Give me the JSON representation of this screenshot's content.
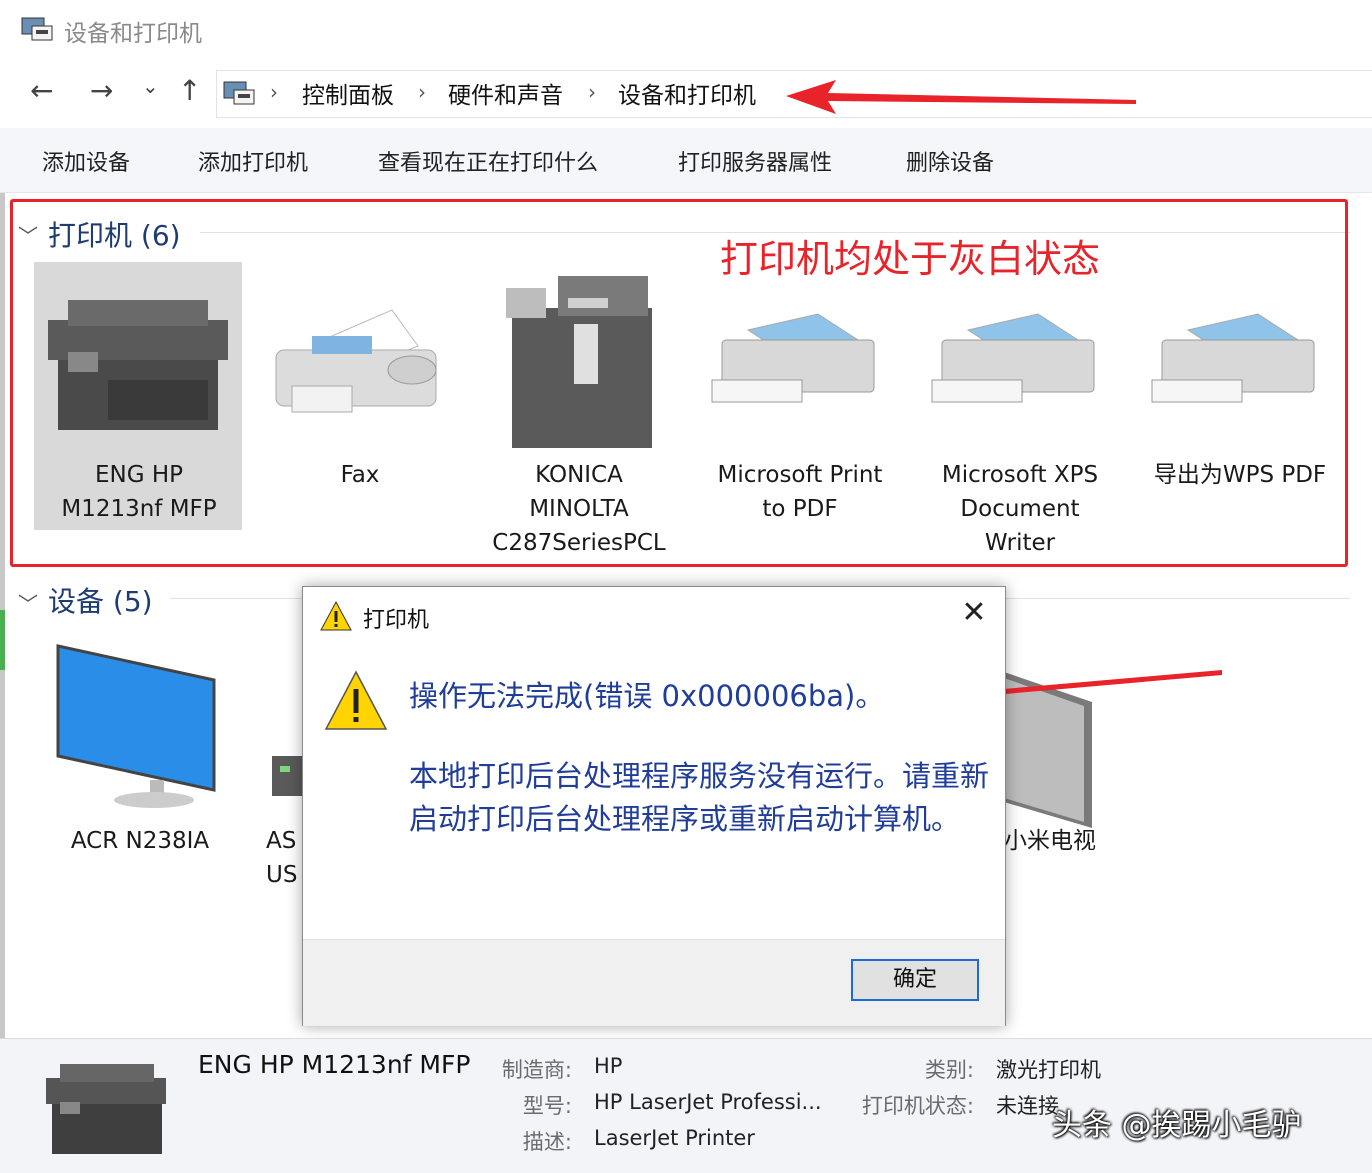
{
  "window": {
    "title": "设备和打印机"
  },
  "nav": {
    "back": "←",
    "forward": "→",
    "recent": "⌄",
    "up": "↑",
    "breadcrumb": [
      "控制面板",
      "硬件和声音",
      "设备和打印机"
    ],
    "sep": "›"
  },
  "toolbar": {
    "items": [
      "添加设备",
      "添加打印机",
      "查看现在正在打印什么",
      "打印服务器属性",
      "删除设备"
    ]
  },
  "printers": {
    "header": "打印机 (6)",
    "annotation": "打印机均处于灰白状态",
    "items": [
      {
        "line1": "ENG HP",
        "line2": "M1213nf MFP",
        "line3": ""
      },
      {
        "line1": "Fax",
        "line2": "",
        "line3": ""
      },
      {
        "line1": "KONICA",
        "line2": "MINOLTA",
        "line3": "C287SeriesPCL"
      },
      {
        "line1": "Microsoft Print",
        "line2": "to PDF",
        "line3": ""
      },
      {
        "line1": "Microsoft XPS",
        "line2": "Document",
        "line3": "Writer"
      },
      {
        "line1": "导出为WPS PDF",
        "line2": "",
        "line3": ""
      }
    ]
  },
  "devices": {
    "header": "设备 (5)",
    "items": [
      {
        "line1": "ACR N238IA",
        "line2": ""
      },
      {
        "line1": "AS",
        "line2": "US"
      },
      {
        "line1": "小米电视",
        "line2": ""
      }
    ]
  },
  "dialog": {
    "title": "打印机",
    "close": "✕",
    "message1": "操作无法完成(错误 0x000006ba)。",
    "message2": "本地打印后台处理程序服务没有运行。请重新启动打印后台处理程序或重新启动计算机。",
    "ok": "确定"
  },
  "details": {
    "name": "ENG HP M1213nf MFP",
    "manufacturer_label": "制造商:",
    "manufacturer": "HP",
    "model_label": "型号:",
    "model": "HP LaserJet Professi...",
    "desc_label": "描述:",
    "desc": "LaserJet Printer",
    "category_label": "类别:",
    "category": "激光打印机",
    "status_label": "打印机状态:",
    "status": "未连接"
  },
  "watermark": "头条 @挨踢小毛驴",
  "colors": {
    "annotation_red": "#e8232a",
    "dialog_text_blue": "#1f3d99",
    "header_blue": "#1e3c72"
  }
}
